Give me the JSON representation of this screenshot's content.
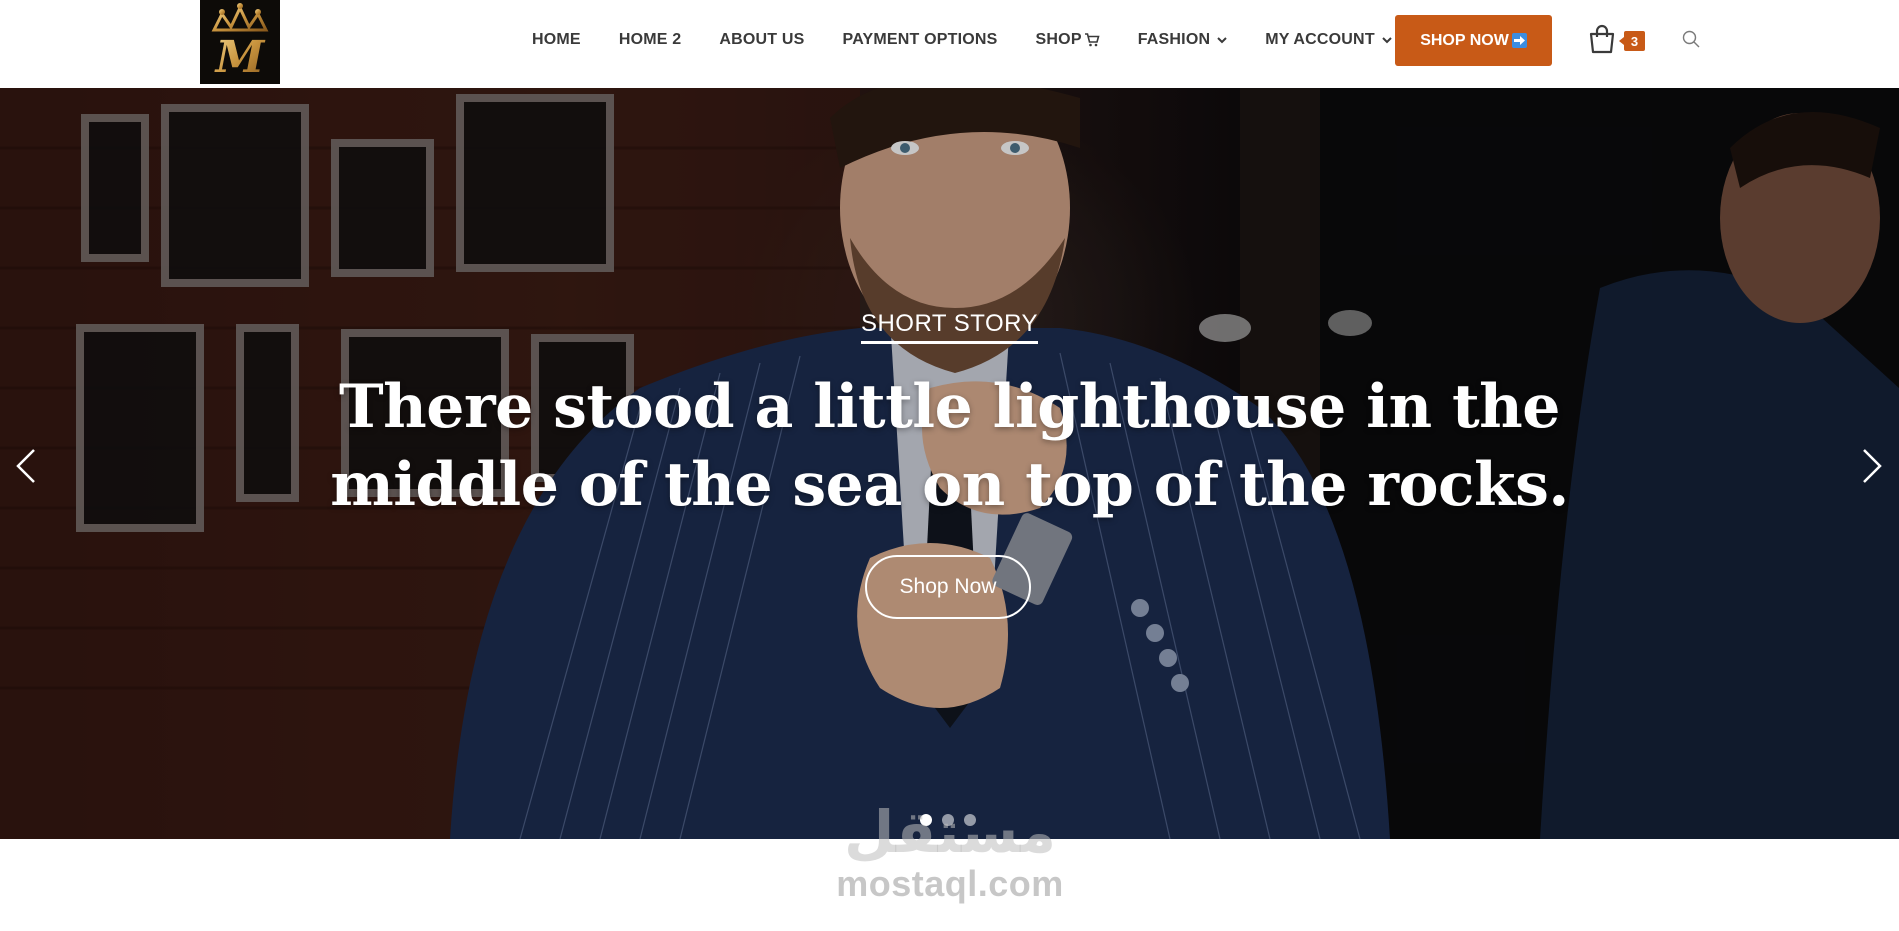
{
  "header": {
    "logo_letter": "M",
    "nav": [
      {
        "label": "HOME"
      },
      {
        "label": "HOME 2"
      },
      {
        "label": "ABOUT US"
      },
      {
        "label": "PAYMENT OPTIONS"
      },
      {
        "label": "SHOP",
        "icon": "cart-icon"
      },
      {
        "label": "FASHION",
        "icon": "chevron-down-icon"
      },
      {
        "label": "MY ACCOUNT",
        "icon": "chevron-down-icon"
      }
    ],
    "cta_label": "SHOP NOW",
    "cta_icon": "arrow-right-icon",
    "cart_count": "3",
    "accent_color": "#c85a17"
  },
  "hero": {
    "subtitle": "SHORT STORY",
    "headline": "There stood a little lighthouse in the middle of the sea on top of the rocks.",
    "button_label": "Shop Now",
    "slides_total": 3,
    "active_slide": 1
  },
  "watermark": {
    "arabic": "مستقل",
    "latin": "mostaql.com"
  }
}
